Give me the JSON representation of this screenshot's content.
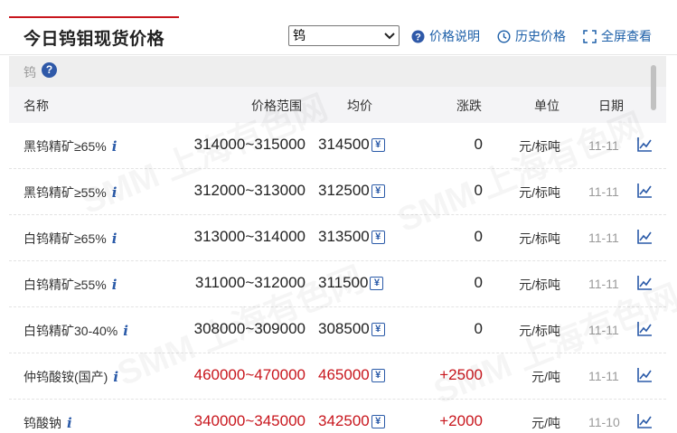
{
  "header": {
    "title": "今日钨钼现货价格",
    "select_value": "钨",
    "links": [
      {
        "label": "价格说明",
        "icon": "question-circle-icon"
      },
      {
        "label": "历史价格",
        "icon": "clock-icon"
      },
      {
        "label": "全屏查看",
        "icon": "fullscreen-icon"
      }
    ]
  },
  "section": {
    "label": "钨",
    "help": "?"
  },
  "columns": {
    "name": "名称",
    "range": "价格范围",
    "avg": "均价",
    "change": "涨跌",
    "unit": "单位",
    "date": "日期"
  },
  "watermark": "SMM 上海有色网",
  "rows": [
    {
      "name": "黑钨精矿≥65%",
      "info": "i",
      "range": "314000~315000",
      "avg": "314500",
      "change": "0",
      "unit": "元/标吨",
      "date": "11-11",
      "up": false
    },
    {
      "name": "黑钨精矿≥55%",
      "info": "i",
      "range": "312000~313000",
      "avg": "312500",
      "change": "0",
      "unit": "元/标吨",
      "date": "11-11",
      "up": false
    },
    {
      "name": "白钨精矿≥65%",
      "info": "i",
      "range": "313000~314000",
      "avg": "313500",
      "change": "0",
      "unit": "元/标吨",
      "date": "11-11",
      "up": false
    },
    {
      "name": "白钨精矿≥55%",
      "info": "i",
      "range": "311000~312000",
      "avg": "311500",
      "change": "0",
      "unit": "元/标吨",
      "date": "11-11",
      "up": false
    },
    {
      "name": "白钨精矿30-40%",
      "info": "i",
      "range": "308000~309000",
      "avg": "308500",
      "change": "0",
      "unit": "元/标吨",
      "date": "11-11",
      "up": false
    },
    {
      "name": "仲钨酸铵(国产)",
      "info": "i",
      "range": "460000~470000",
      "avg": "465000",
      "change": "+2500",
      "unit": "元/吨",
      "date": "11-11",
      "up": true
    },
    {
      "name": "钨酸钠",
      "info": "i",
      "range": "340000~345000",
      "avg": "342500",
      "change": "+2000",
      "unit": "元/吨",
      "date": "11-10",
      "up": true
    }
  ],
  "colors": {
    "accent": "#c8161d",
    "link": "#1c5fa8",
    "up": "#c8161d"
  }
}
